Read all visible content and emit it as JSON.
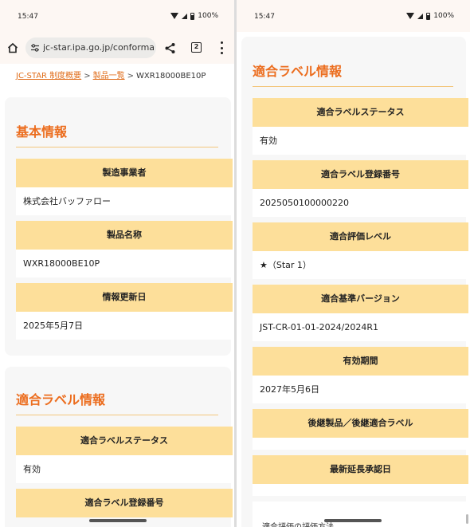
{
  "status": {
    "time": "15:47",
    "battery": "100%"
  },
  "browser": {
    "url": "jc-star.ipa.go.jp/conformance",
    "tab_count": "2"
  },
  "breadcrumb": {
    "items": [
      "JC-STAR 制度概要",
      "製品一覧"
    ],
    "separator": ">",
    "current": "WXR18000BE10P"
  },
  "basic_info": {
    "title": "基本情報",
    "fields": [
      {
        "label": "製造事業者",
        "value": "株式会社バッファロー"
      },
      {
        "label": "製品名称",
        "value": "WXR18000BE10P"
      },
      {
        "label": "情報更新日",
        "value": "2025年5月7日"
      }
    ]
  },
  "label_info": {
    "title": "適合ラベル情報",
    "fields": [
      {
        "label": "適合ラベルステータス",
        "value": "有効"
      },
      {
        "label": "適合ラベル登録番号",
        "value": "2025050100000220"
      },
      {
        "label": "適合評価レベル",
        "value": "★（Star 1）"
      },
      {
        "label": "適合基準バージョン",
        "value": "JST-CR-01-01-2024/2024R1"
      },
      {
        "label": "有効期間",
        "value": "2027年5月6日"
      },
      {
        "label": "後継製品／後継適合ラベル",
        "value": ""
      },
      {
        "label": "最新延長承認日",
        "value": ""
      }
    ],
    "cut_off_label": "適合評価の評価方法"
  }
}
